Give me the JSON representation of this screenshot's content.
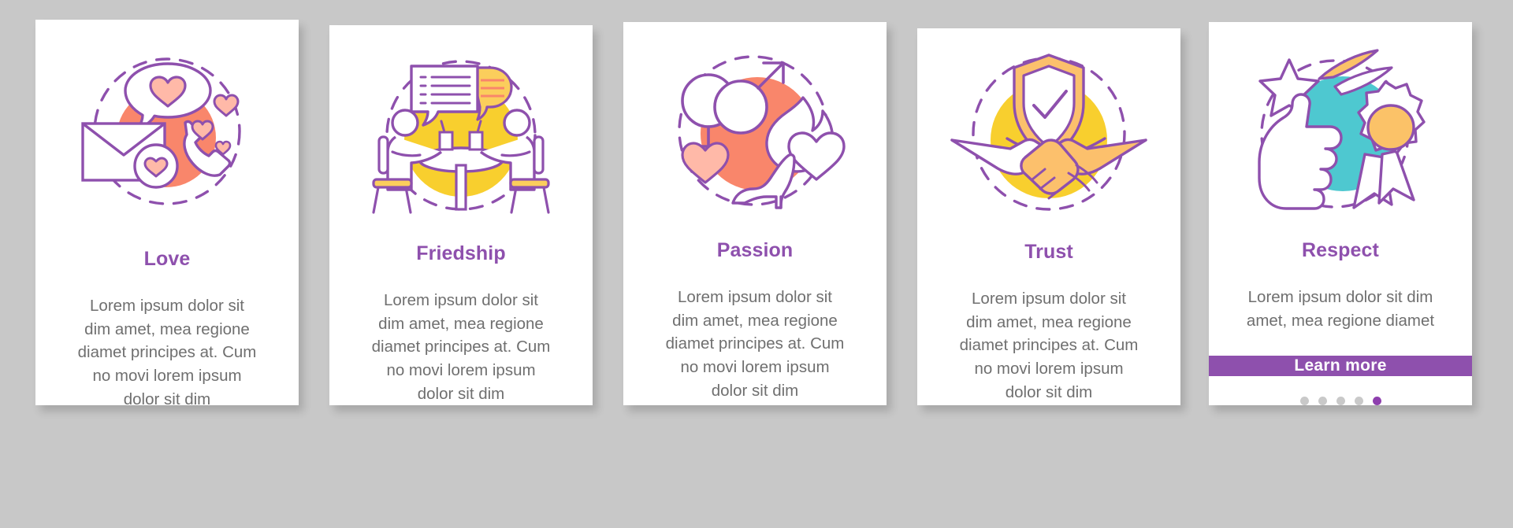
{
  "page": {
    "background_color": "#c8c8c8",
    "card_background": "#ffffff",
    "accent_purple": "#8e50ad",
    "dot_active_color": "#8e3fae",
    "dot_inactive_color": "#c9c9c9",
    "body_text_color": "#6f6f6f",
    "total_steps": 5
  },
  "cards": [
    {
      "id": "love",
      "title": "Love",
      "description": "Lorem ipsum dolor sit dim amet, mea regione diamet principes at. Cum no movi lorem ipsum dolor sit dim",
      "icon": "love-mail-heart-phone-icon",
      "blob_color": "#f9866b",
      "accent_fill": "#ffb9a8",
      "active_dot_index": 0,
      "has_learn_more": false,
      "learn_more_label": ""
    },
    {
      "id": "friedship",
      "title": "Friedship",
      "description": "Lorem ipsum dolor sit dim amet, mea regione diamet principes at. Cum no movi lorem ipsum dolor sit dim",
      "icon": "friendship-two-people-table-chat-icon",
      "blob_color": "#f8cf2e",
      "accent_fill": "#fbce5c",
      "active_dot_index": 1,
      "has_learn_more": false,
      "learn_more_label": ""
    },
    {
      "id": "passion",
      "title": "Passion",
      "description": "Lorem ipsum dolor sit dim amet, mea regione diamet principes at. Cum no movi lorem ipsum dolor sit dim",
      "icon": "passion-gender-symbols-heel-flame-heart-icon",
      "blob_color": "#f9866b",
      "accent_fill": "#ffb9a8",
      "active_dot_index": 2,
      "has_learn_more": false,
      "learn_more_label": ""
    },
    {
      "id": "trust",
      "title": "Trust",
      "description": "Lorem ipsum dolor sit dim amet, mea regione diamet principes at. Cum no movi lorem ipsum dolor sit dim",
      "icon": "trust-shield-check-handshake-icon",
      "blob_color": "#f8cf2e",
      "accent_fill": "#fcc06c",
      "active_dot_index": 3,
      "has_learn_more": false,
      "learn_more_label": ""
    },
    {
      "id": "respect",
      "title": "Respect",
      "description": "Lorem ipsum dolor sit dim amet, mea regione diamet",
      "icon": "respect-thumbs-up-star-medal-icon",
      "blob_color": "#4ec8d0",
      "accent_fill": "#fbc268",
      "active_dot_index": 4,
      "has_learn_more": true,
      "learn_more_label": "Learn more"
    }
  ]
}
